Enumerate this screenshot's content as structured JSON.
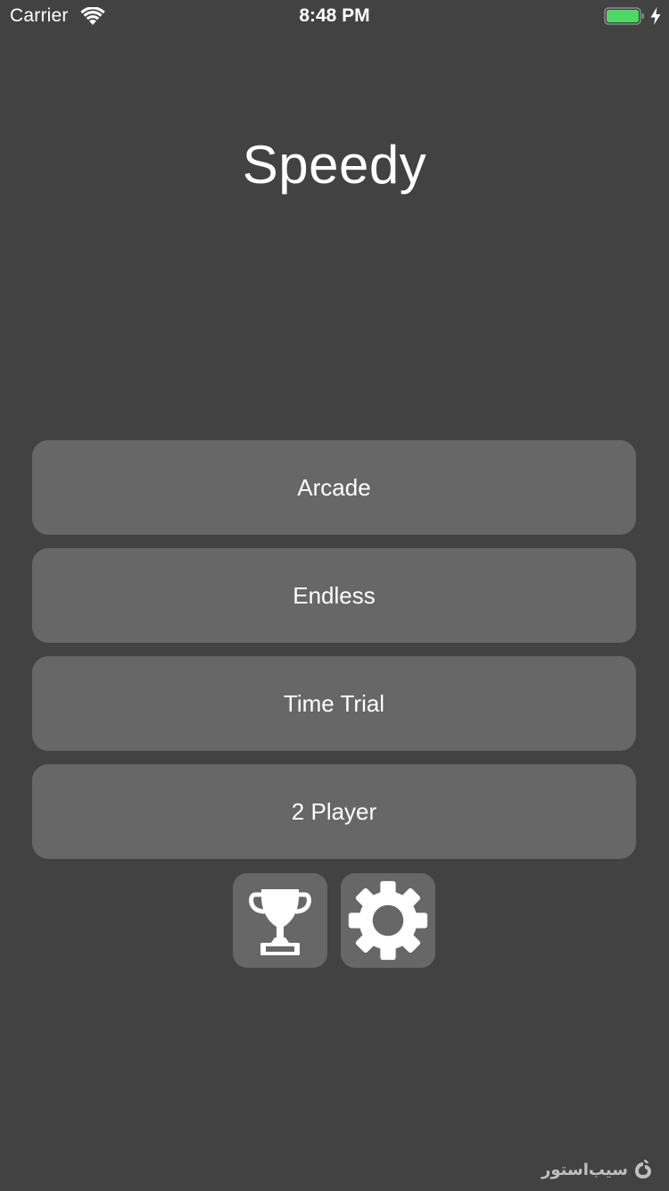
{
  "status_bar": {
    "carrier": "Carrier",
    "time": "8:48 PM",
    "battery_color": "#4cd964"
  },
  "app": {
    "title": "Speedy"
  },
  "menu": {
    "buttons": [
      {
        "label": "Arcade"
      },
      {
        "label": "Endless"
      },
      {
        "label": "Time Trial"
      },
      {
        "label": "2 Player"
      }
    ]
  },
  "icons": {
    "leaderboard": "trophy-icon",
    "settings": "gear-icon"
  },
  "watermark": {
    "text": "سیب‌استور"
  },
  "colors": {
    "background": "#424242",
    "button": "#676767",
    "text": "#ffffff"
  }
}
